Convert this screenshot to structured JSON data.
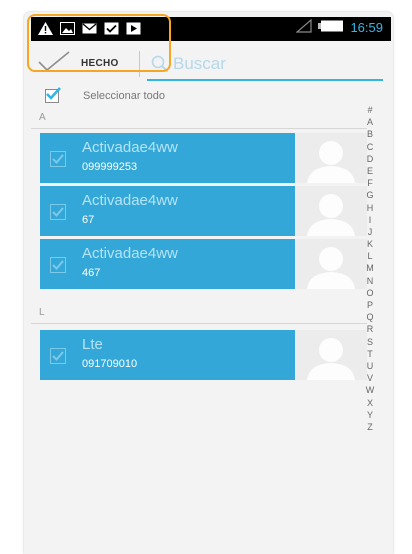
{
  "status_bar": {
    "icons": [
      "warning-icon",
      "image-icon",
      "mail-icon",
      "check-icon",
      "play-icon"
    ],
    "time": "16:59"
  },
  "action_bar": {
    "done_label": "HECHO",
    "search_placeholder": "Buscar"
  },
  "select_all": {
    "label": "Seleccionar todo",
    "checked": true
  },
  "sections": [
    {
      "letter": "A",
      "contacts": [
        {
          "name": "Activadae4ww",
          "phone": "099999253",
          "checked": true
        },
        {
          "name": "Activadae4ww",
          "phone": "67",
          "checked": true
        },
        {
          "name": "Activadae4ww",
          "phone": "467",
          "checked": true
        }
      ]
    },
    {
      "letter": "L",
      "contacts": [
        {
          "name": "Lte",
          "phone": "091709010",
          "checked": true
        }
      ]
    }
  ],
  "index_letters": [
    "#",
    "A",
    "B",
    "C",
    "D",
    "E",
    "F",
    "G",
    "H",
    "I",
    "J",
    "K",
    "L",
    "M",
    "N",
    "O",
    "P",
    "Q",
    "R",
    "S",
    "T",
    "U",
    "V",
    "W",
    "X",
    "Y",
    "Z"
  ],
  "colors": {
    "accent": "#33b5e5",
    "row_selected": "#33a8d8",
    "highlight": "#f5a623"
  }
}
